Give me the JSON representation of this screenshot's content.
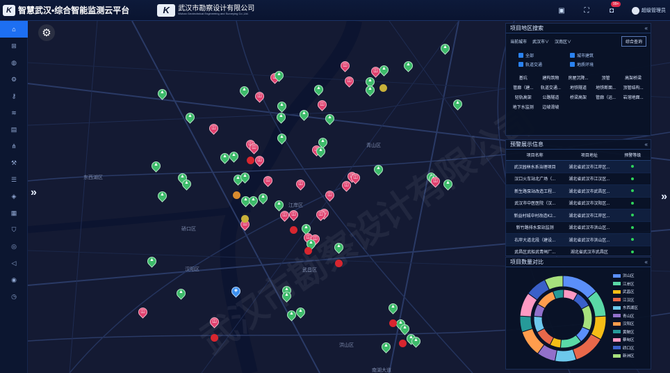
{
  "header": {
    "platform_title": "智慧武汉•综合智能监测云平台",
    "brand_logo_text": "K",
    "company_logo_text": "K",
    "company_name": "武汉市勘察设计有限公司",
    "company_name_en": "Wuhan Geotechnical Engineering and Surveying Co.,Ltd.",
    "notification_count": "99+",
    "user_name": "超级管理员",
    "icons": [
      "qrcode-icon",
      "fullscreen-icon",
      "bell-icon",
      "user-avatar-icon"
    ]
  },
  "sidebar": {
    "items": [
      {
        "name": "home-icon",
        "glyph": "⌂"
      },
      {
        "name": "grid-icon",
        "glyph": "⊞"
      },
      {
        "name": "bell-icon",
        "glyph": "◍"
      },
      {
        "name": "settings-icon",
        "glyph": "⚙"
      },
      {
        "name": "key-icon",
        "glyph": "⚷"
      },
      {
        "name": "signal-icon",
        "glyph": "≋"
      },
      {
        "name": "document-icon",
        "glyph": "▤"
      },
      {
        "name": "network-icon",
        "glyph": "⋔"
      },
      {
        "name": "wrench-icon",
        "glyph": "⚒"
      },
      {
        "name": "list-icon",
        "glyph": "☰"
      },
      {
        "name": "tag-icon",
        "glyph": "◈"
      },
      {
        "name": "keyboard-icon",
        "glyph": "▦"
      },
      {
        "name": "shield-icon",
        "glyph": "⛉"
      },
      {
        "name": "coin-icon",
        "glyph": "◎"
      },
      {
        "name": "speaker-icon",
        "glyph": "◁"
      },
      {
        "name": "location-icon",
        "glyph": "◉"
      },
      {
        "name": "clock-icon",
        "glyph": "◷"
      }
    ]
  },
  "map": {
    "watermark": "武汉市勘察设计有限公司",
    "districts": [
      {
        "label": "青山区"
      },
      {
        "label": "江岸区"
      },
      {
        "label": "硚口区"
      },
      {
        "label": "汉阳区"
      },
      {
        "label": "武昌区"
      },
      {
        "label": "洪山区"
      },
      {
        "label": "东西湖区"
      },
      {
        "label": "南湖大道"
      }
    ],
    "left_arrow": "»",
    "right_arrow": "»"
  },
  "region_search": {
    "title": "项目地区搜索",
    "collapse": "«",
    "current_city_label": "当前城市",
    "city_select": "武汉市∨",
    "district_select": "汉南区∨",
    "query_button": "综合查询",
    "checkboxes": [
      "全部",
      "城市建筑",
      "轨道交通",
      "地质环境"
    ],
    "categories": [
      "基坑",
      "建构筑物",
      "房屋沉降...",
      "顶管",
      "高架桥梁",
      "管廊（建...",
      "轨道交通...",
      "地铁隧道",
      "地铁断面...",
      "顶管结构...",
      "轻轨高架",
      "公路隧道",
      "桥梁高架",
      "管廊（运...",
      "岩溶地面...",
      "地下水监测",
      "边坡滑坡"
    ]
  },
  "alarm_info": {
    "title": "预警展示信息",
    "collapse": "«",
    "columns": [
      "项目名称",
      "项目地址",
      "预警等级"
    ],
    "rows": [
      {
        "name": "武汉园林水系治理项目",
        "address": "湖北省武汉市江岸区..."
      },
      {
        "name": "汉口火车站北广场（...",
        "address": "湖北省武汉市江汉区..."
      },
      {
        "name": "新生路泵站改造工程...",
        "address": "湖北省武汉市武昌区..."
      },
      {
        "name": "武汉市中医医院（汉...",
        "address": "湖北省武汉市汉阳区..."
      },
      {
        "name": "新益村城中村改造K2...",
        "address": "湖北省武汉市江岸区..."
      },
      {
        "name": "新竹路排水泵站监测",
        "address": "湖北省武汉市洪山区..."
      },
      {
        "name": "右岸大道北段（建设...",
        "address": "湖北省武汉市洪山区..."
      },
      {
        "name": "武昌区武船武青闸厂...",
        "address": "湖北省武汉市武昌区"
      }
    ]
  },
  "project_stats": {
    "title": "项目数量对比",
    "collapse": "«",
    "legend": [
      {
        "label": "洪山区",
        "color": "#5b8ff9"
      },
      {
        "label": "江岸区",
        "color": "#5ad8a6"
      },
      {
        "label": "武昌区",
        "color": "#f6bd16"
      },
      {
        "label": "江汉区",
        "color": "#e8684a"
      },
      {
        "label": "东西湖区",
        "color": "#6dc8ec"
      },
      {
        "label": "青山区",
        "color": "#9270ca"
      },
      {
        "label": "汉阳区",
        "color": "#ff9d4d"
      },
      {
        "label": "黄陂区",
        "color": "#269a99"
      },
      {
        "label": "蔡甸区",
        "color": "#ff99c3"
      },
      {
        "label": "硚口区",
        "color": "#3a60c9"
      },
      {
        "label": "新洲区",
        "color": "#a7e07d"
      }
    ]
  }
}
